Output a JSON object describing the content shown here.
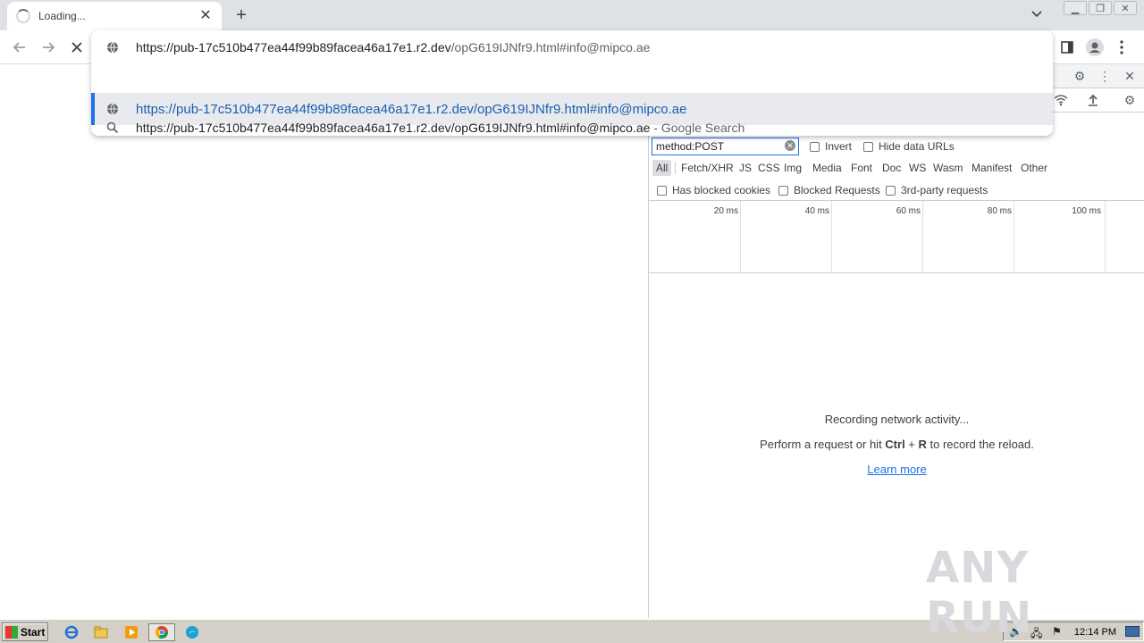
{
  "browser": {
    "tab": {
      "title": "Loading..."
    },
    "omnibox": {
      "input_host": "https://pub-17c510b477ea44f99b89facea46a17e1.r2.dev",
      "input_path": "/opG619IJNfr9.html#info@mipco.ae",
      "suggestion_url": "https://pub-17c510b477ea44f99b89facea46a17e1.r2.dev/opG619IJNfr9.html#info@mipco.ae",
      "search_query": "https://pub-17c510b477ea44f99b89facea46a17e1.r2.dev/opG619IJNfr9.html#info@mipco.ae",
      "search_suffix": " - Google Search"
    }
  },
  "devtools": {
    "filter_value": "method:POST",
    "invert_label": "Invert",
    "hide_data_urls_label": "Hide data URLs",
    "types": [
      "All",
      "Fetch/XHR",
      "JS",
      "CSS",
      "Img",
      "Media",
      "Font",
      "Doc",
      "WS",
      "Wasm",
      "Manifest",
      "Other"
    ],
    "blocked_cookies_label": "Has blocked cookies",
    "blocked_requests_label": "Blocked Requests",
    "third_party_label": "3rd-party requests",
    "timeline_ticks": [
      "20 ms",
      "40 ms",
      "60 ms",
      "80 ms",
      "100 ms"
    ],
    "empty_line1": "Recording network activity...",
    "empty_line2_pre": "Perform a request or hit ",
    "empty_key1": "Ctrl",
    "empty_plus": " + ",
    "empty_key2": "R",
    "empty_line2_post": " to record the reload.",
    "learn_more": "Learn more"
  },
  "watermark": "ANY RUN",
  "taskbar": {
    "start_label": "Start",
    "clock": "12:14 PM"
  }
}
